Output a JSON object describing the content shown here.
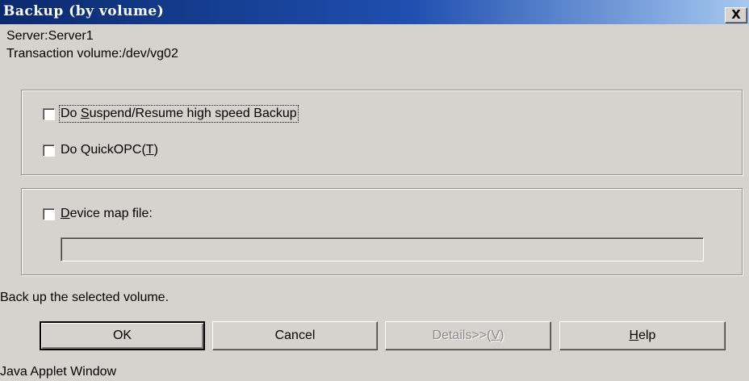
{
  "window": {
    "title": "Backup (by volume)",
    "close_label": "X"
  },
  "info": {
    "server": "Server:Server1",
    "volume": "Transaction volume:/dev/vg02"
  },
  "options": {
    "suspend_resume": {
      "prefix": "Do ",
      "mnemonic": "S",
      "suffix": "uspend/Resume high speed Backup",
      "checked": false
    },
    "quickopc": {
      "label": "Do QuickOPC(",
      "mnemonic": "T",
      "suffix": ")",
      "checked": false
    }
  },
  "device_map": {
    "mnemonic": "D",
    "label": "evice map file:",
    "checked": false,
    "value": ""
  },
  "status_text": "Back up the selected volume.",
  "buttons": {
    "ok": "OK",
    "cancel": "Cancel",
    "details": "Details>>(",
    "details_mnemonic": "V",
    "details_suffix": ")",
    "help_mnemonic": "H",
    "help": "elp"
  },
  "footer": "Java Applet Window"
}
